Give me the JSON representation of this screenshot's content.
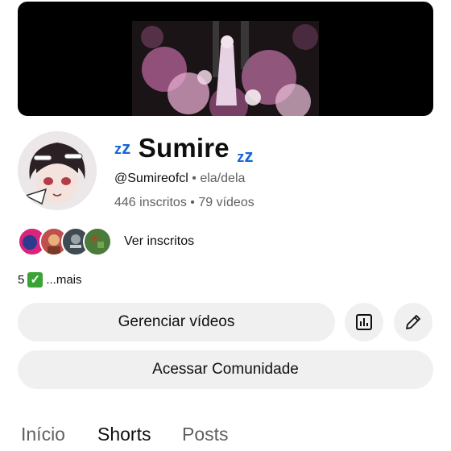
{
  "channel": {
    "name": "Sumire",
    "zz_left": "z",
    "zz_left_big": "z",
    "zz_right": "z",
    "zz_right_big": "z",
    "handle": "@Sumireofcl",
    "separator": "•",
    "pronouns": "ela/dela",
    "subscribers": "446 inscritos",
    "videos": "79 vídeos"
  },
  "subscribers_preview": {
    "label": "Ver inscritos",
    "avatar_colors": [
      "#d8247a",
      "#c0504d",
      "#3f4a52",
      "#4b7a3a"
    ]
  },
  "description": {
    "prefix": "5",
    "emoji": "check-mark-icon",
    "more": "...mais"
  },
  "buttons": {
    "manage": "Gerenciar vídeos",
    "community": "Acessar Comunidade"
  },
  "tabs": [
    {
      "label": "Início",
      "active": false
    },
    {
      "label": "Shorts",
      "active": true
    },
    {
      "label": "Posts",
      "active": false
    }
  ],
  "colors": {
    "accent_zz": "#1565d8",
    "pill_bg": "#f0f0f0",
    "muted_text": "#606060"
  }
}
